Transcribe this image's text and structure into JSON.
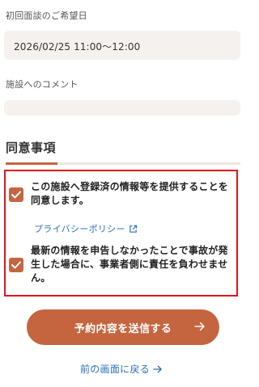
{
  "interview": {
    "label": "初回面談のご希望日",
    "value": "2026/02/25 11:00〜12:00"
  },
  "comment": {
    "label": "施設へのコメント",
    "value": ""
  },
  "consent": {
    "title": "同意事項",
    "items": [
      {
        "text": "この施設へ登録済の情報等を提供することを同意します。",
        "checked": true
      },
      {
        "text": "最新の情報を申告しなかったことで事故が発生した場合に、事業者側に責任を負わせません。",
        "checked": true
      }
    ],
    "privacy_link": "プライバシーポリシー",
    "privacy_icon": "external-link-icon"
  },
  "actions": {
    "submit_label": "予約内容を送信する",
    "submit_icon": "arrow-right-icon",
    "back_label": "前の画面に戻る",
    "back_icon": "arrow-right-icon"
  },
  "colors": {
    "accent": "#c5653f",
    "link": "#2b70b8",
    "highlight_border": "#e0141c",
    "field_background": "#f5f1ee"
  }
}
